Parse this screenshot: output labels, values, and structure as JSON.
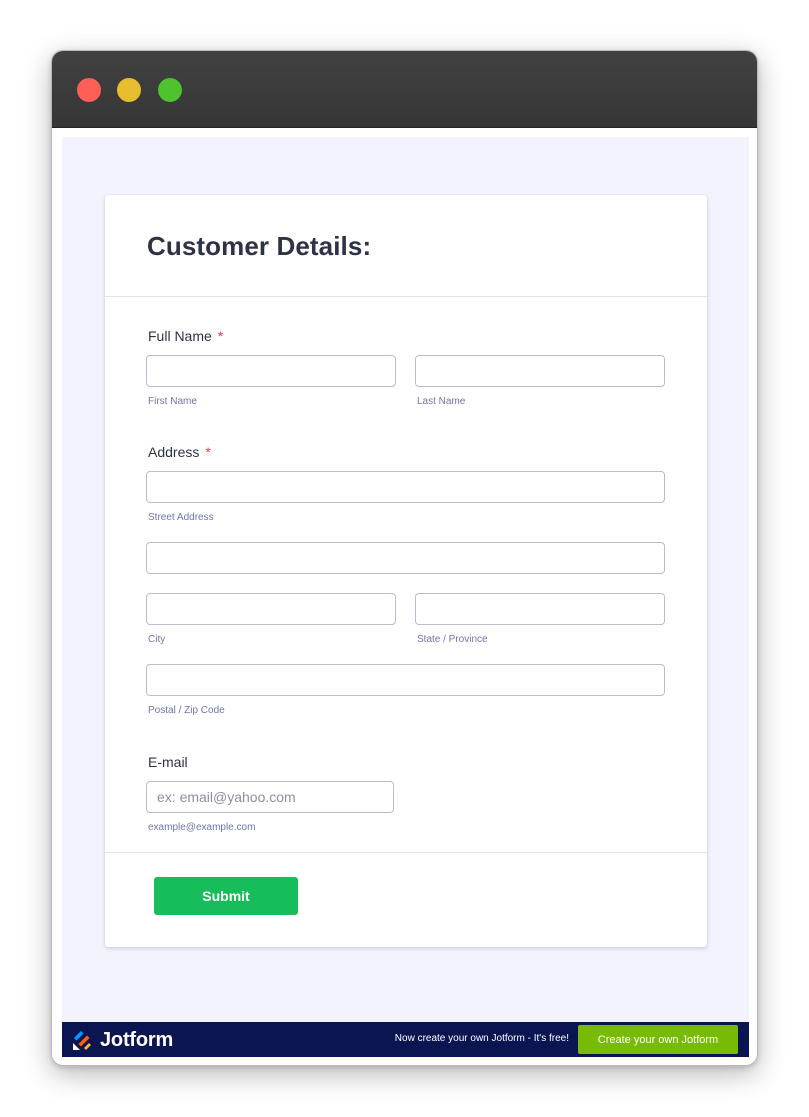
{
  "form": {
    "title": "Customer Details:",
    "full_name": {
      "label": "Full Name",
      "required_mark": "*",
      "first_value": "",
      "last_value": "",
      "first_sublabel": "First Name",
      "last_sublabel": "Last Name"
    },
    "address": {
      "label": "Address",
      "required_mark": "*",
      "street_value": "",
      "street_sublabel": "Street Address",
      "line2_value": "",
      "city_value": "",
      "city_sublabel": "City",
      "state_value": "",
      "state_sublabel": "State / Province",
      "postal_value": "",
      "postal_sublabel": "Postal / Zip Code"
    },
    "email": {
      "label": "E-mail",
      "placeholder": "ex: email@yahoo.com",
      "value": "",
      "sublabel": "example@example.com"
    },
    "submit_label": "Submit"
  },
  "footer": {
    "brand": "Jotform",
    "promo_text": "Now create your own Jotform - It's free!",
    "cta_label": "Create your own Jotform"
  },
  "colors": {
    "titlebar": "#3a3a3a",
    "page_background": "#f3f3fe",
    "submit": "#18bd5b",
    "required": "#f23a3c",
    "footer": "#0a1551",
    "cta": "#78bb07"
  },
  "icons": {
    "window_close": "red-circle",
    "window_minimize": "yellow-circle",
    "window_maximize": "green-circle",
    "brand_logo": "jotform-logo-icon"
  }
}
